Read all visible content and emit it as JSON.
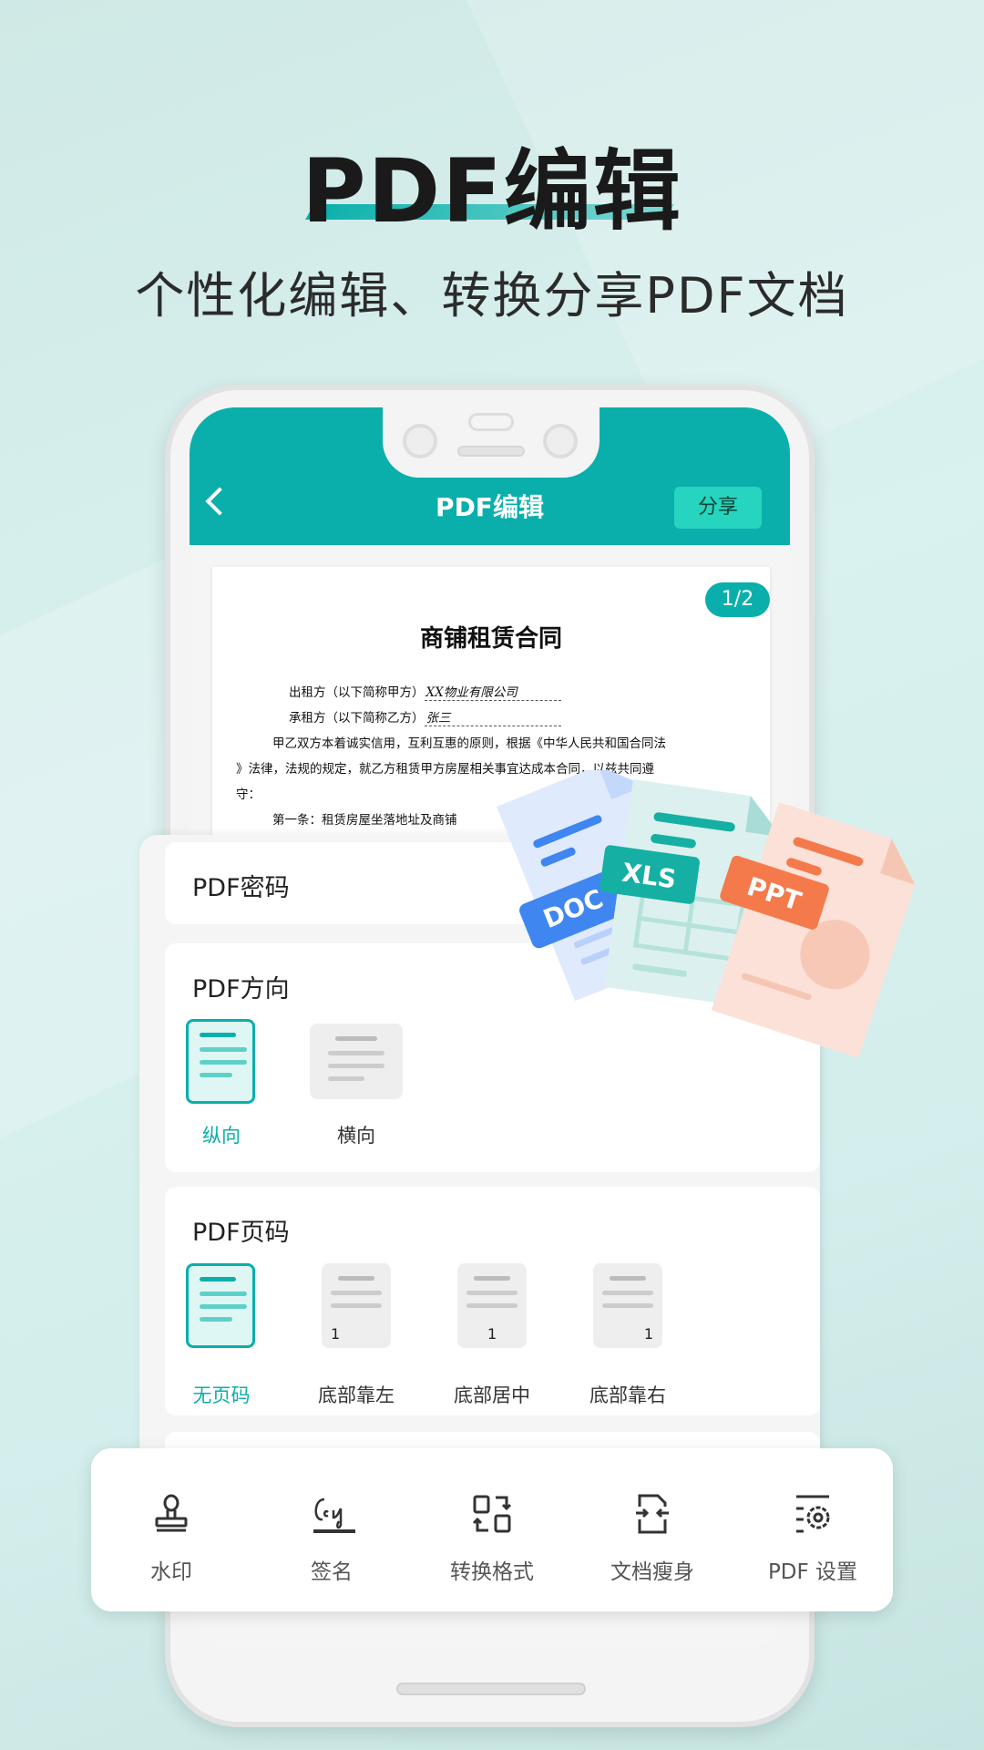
{
  "hero": {
    "title": "PDF编辑",
    "subtitle": "个性化编辑、转换分享PDF文档"
  },
  "app": {
    "title": "PDF编辑",
    "share_label": "分享",
    "back_icon": "chevron-left-icon",
    "accent": "#0aafab"
  },
  "document": {
    "page_indicator": "1/2",
    "title": "商铺租赁合同",
    "lessor_label": "出租方（以下简称甲方）",
    "lessor_value": "XX物业有限公司",
    "lessee_label": "承租方（以下简称乙方）",
    "lessee_value": "张三",
    "para1": "甲乙双方本着诚实信用，互利互惠的原则，根据《中华人民共和国合同法",
    "para2": "》法律，法规的规定，就乙方租赁甲方房屋相关事宜达成本合同，以兹共同遵",
    "para3": "守：",
    "clause1": "第一条：租赁房屋坐落地址及商铺"
  },
  "file_types": [
    "DOC",
    "XLS",
    "PPT"
  ],
  "settings": {
    "password": {
      "title": "PDF密码"
    },
    "orientation": {
      "title": "PDF方向",
      "options": [
        {
          "label": "纵向",
          "selected": true
        },
        {
          "label": "横向",
          "selected": false
        }
      ]
    },
    "page_number": {
      "title": "PDF页码",
      "sample_number": "1",
      "options": [
        {
          "label": "无页码",
          "selected": true
        },
        {
          "label": "底部靠左",
          "selected": false
        },
        {
          "label": "底部居中",
          "selected": false
        },
        {
          "label": "底部靠右",
          "selected": false
        }
      ]
    }
  },
  "toolbar": [
    {
      "label": "水印",
      "icon": "stamp-icon"
    },
    {
      "label": "签名",
      "icon": "signature-icon"
    },
    {
      "label": "转换格式",
      "icon": "convert-icon"
    },
    {
      "label": "文档瘦身",
      "icon": "compress-icon"
    },
    {
      "label": "PDF 设置",
      "icon": "settings-icon"
    }
  ]
}
